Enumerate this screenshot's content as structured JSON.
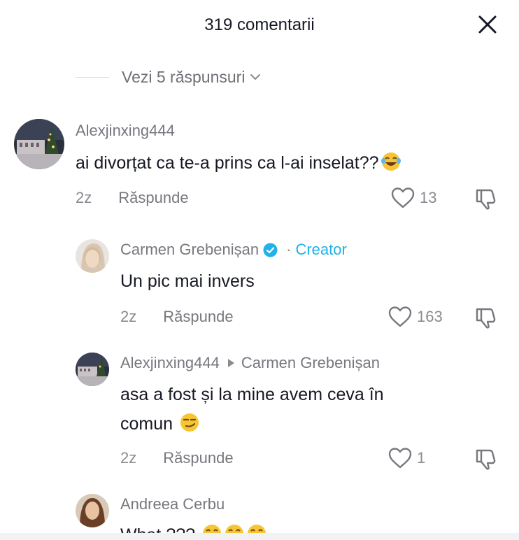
{
  "header": {
    "title": "319 comentarii"
  },
  "view_replies": {
    "label": "Vezi 5 răspunsuri"
  },
  "comments": [
    {
      "username": "Alexjinxing444",
      "text": "ai divorțat ca te-a prins ca l-ai inselat??",
      "emoji": "laughing-tears-emoji",
      "time": "2z",
      "reply_label": "Răspunde",
      "likes": "13"
    },
    {
      "username": "Carmen Grebenișan",
      "creator_label": "Creator",
      "text": "Un pic mai invers",
      "time": "2z",
      "reply_label": "Răspunde",
      "likes": "163"
    },
    {
      "username": "Alexjinxing444",
      "reply_to": "Carmen Grebenișan",
      "text_line1": "asa a fost și la mine avem ceva în",
      "text_line2": "comun",
      "emoji": "smirk-emoji",
      "time": "2z",
      "reply_label": "Răspunde",
      "likes": "1"
    },
    {
      "username": "Andreea Cerbu",
      "text": "What ???",
      "emoji": "laughing-tears-emoji"
    }
  ],
  "colors": {
    "accent": "#20b2e8",
    "muted": "#8a8b91",
    "text": "#161823"
  }
}
